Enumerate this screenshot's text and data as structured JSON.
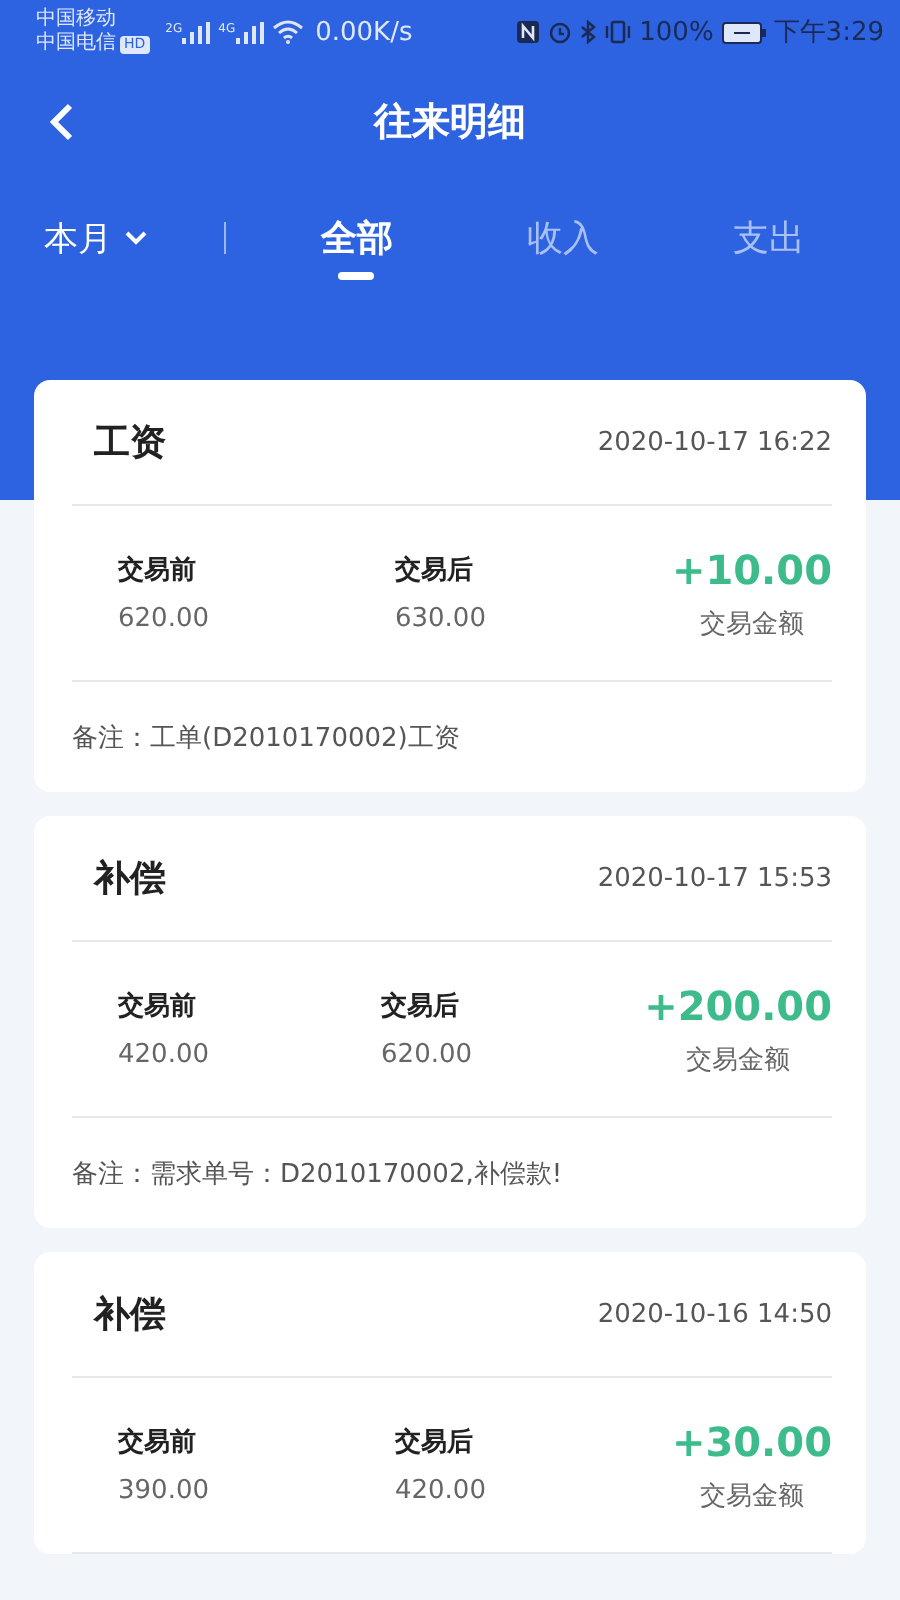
{
  "status_bar": {
    "carriers": [
      "中国移动",
      "中国电信"
    ],
    "hd_badge": "HD",
    "signals": [
      "2G",
      "4G"
    ],
    "net_speed": "0.00K/s",
    "battery": "100%",
    "time": "下午3:29"
  },
  "header": {
    "title": "往来明细"
  },
  "filter": {
    "month": "本月"
  },
  "tabs": [
    {
      "label": "全部",
      "selected": true
    },
    {
      "label": "收入",
      "selected": false
    },
    {
      "label": "支出",
      "selected": false
    }
  ],
  "records": [
    {
      "title": "工资",
      "time": "2020-10-17 16:22",
      "before_label": "交易前",
      "before": "620.00",
      "after_label": "交易后",
      "after": "630.00",
      "amount": "+10.00",
      "amount_label": "交易金额",
      "note": "备注：工单(D2010170002)工资"
    },
    {
      "title": "补偿",
      "time": "2020-10-17 15:53",
      "before_label": "交易前",
      "before": "420.00",
      "after_label": "交易后",
      "after": "620.00",
      "amount": "+200.00",
      "amount_label": "交易金额",
      "note": "备注：需求单号：D2010170002,补偿款!"
    },
    {
      "title": "补偿",
      "time": "2020-10-16 14:50",
      "before_label": "交易前",
      "before": "390.00",
      "after_label": "交易后",
      "after": "420.00",
      "amount": "+30.00",
      "amount_label": "交易金额"
    }
  ]
}
